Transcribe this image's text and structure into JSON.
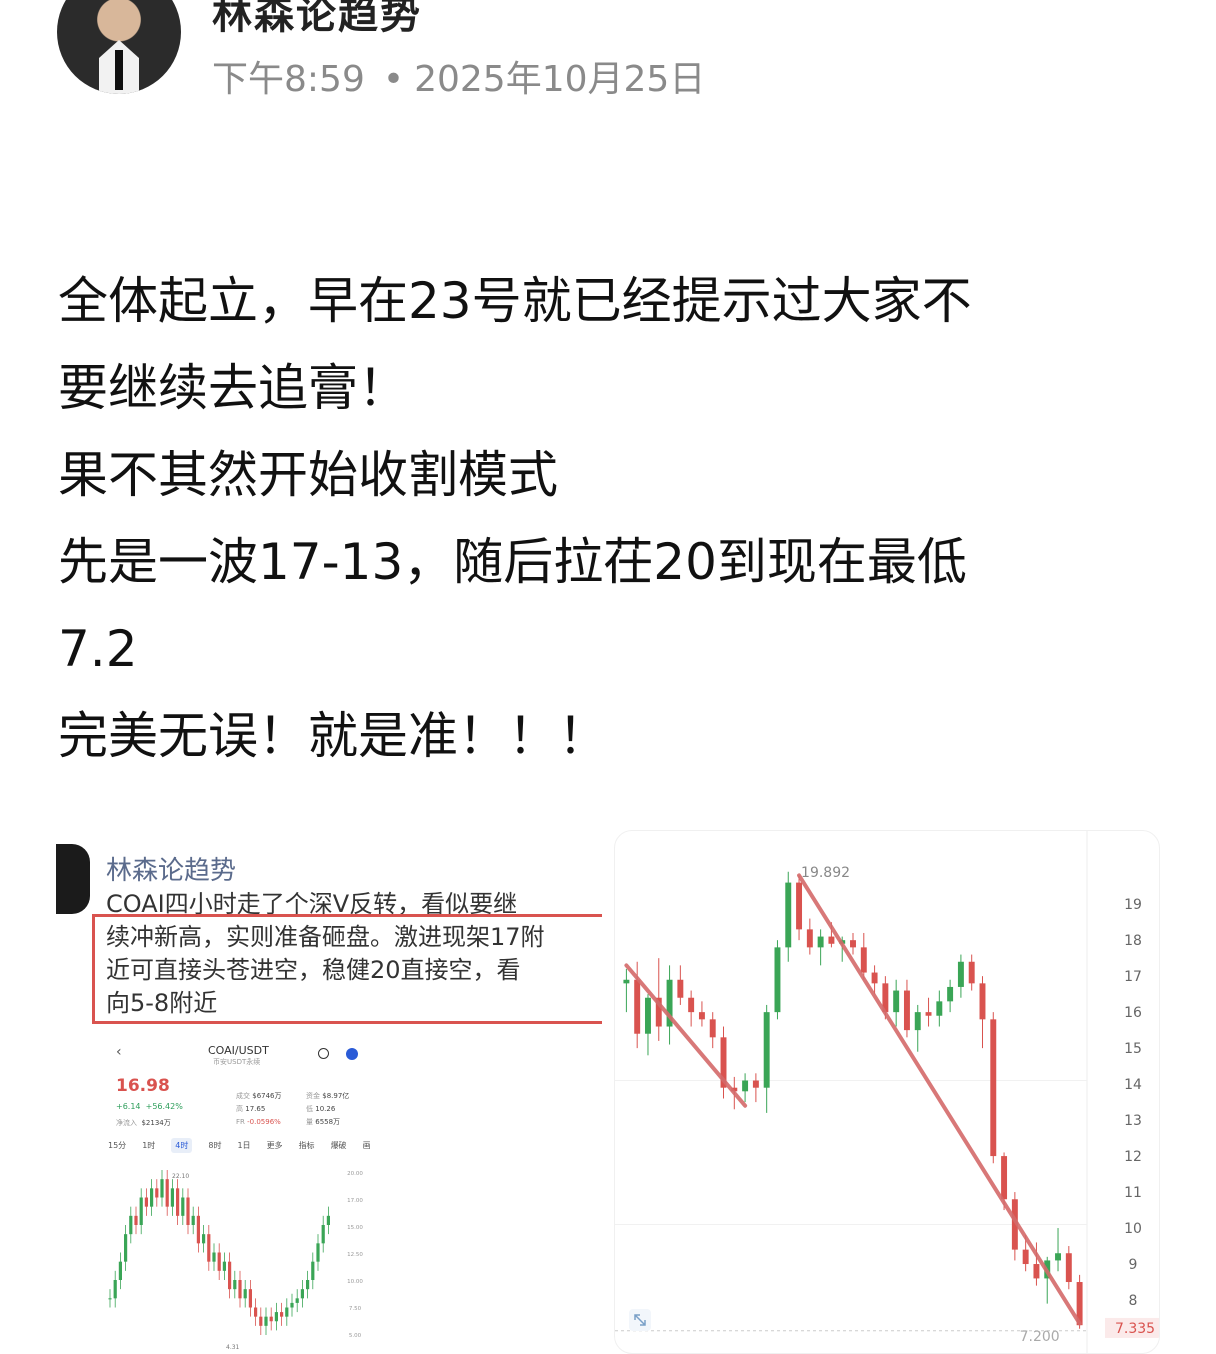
{
  "header": {
    "author": "林森论趋势",
    "time": "下午8:59",
    "date": "2025年10月25日"
  },
  "post": {
    "lines": [
      "全体起立，早在23号就已经提示过大家不",
      "要继续去追膏！",
      "果不其然开始收割模式",
      "先是一波17-13，随后拉�europe20到现在最低",
      "7.2",
      "完美无误！就是准！！！"
    ]
  },
  "left_image": {
    "author": "林森论趋势",
    "text_lines": [
      "COAI四小时走了个深V反转，看似要继",
      "续冲新高，实则准备砸盘。激进现架17附",
      "近可直接头苍进空，稳健20直接空，看",
      "向5-8附近"
    ],
    "pair": "COAI/USDT",
    "pair_sub": "币安USDT永续",
    "price": "16.98",
    "change": "+6.14",
    "change_pct": "+56.42%",
    "net_in": "净流入",
    "net_in_val": "$2134万",
    "stats": [
      {
        "label": "成交",
        "value": "$6746万"
      },
      {
        "label": "高",
        "value": "17.65"
      },
      {
        "label": "低",
        "value": "10.26"
      },
      {
        "label": "资金",
        "value": "$8.97亿"
      },
      {
        "label": "FR",
        "value": "-0.0596%"
      },
      {
        "label": "量",
        "value": "6558万"
      }
    ],
    "tabs": [
      "15分",
      "1时",
      "4时",
      "8时",
      "1日",
      "更多",
      "指标",
      "爆破",
      "画"
    ],
    "active_tab": "4时",
    "mini_chart": {
      "high_label": "22.10",
      "low_label": "4.31",
      "y_ticks": [
        "20.00",
        "17.00",
        "15.00",
        "12.50",
        "10.00",
        "7.50",
        "5.00"
      ]
    }
  },
  "chart_data": {
    "type": "candlestick",
    "title": "",
    "y_ticks": [
      19,
      18,
      17,
      16,
      15,
      14,
      13,
      12,
      11,
      10,
      9,
      8
    ],
    "ylim": [
      7,
      20.2
    ],
    "high_label": "19.892",
    "low_label": "7.200",
    "last_price_label": "7.335",
    "grid": true,
    "candles": [
      {
        "o": 16.8,
        "h": 17.2,
        "l": 16.0,
        "c": 16.9
      },
      {
        "o": 16.9,
        "h": 17.4,
        "l": 15.0,
        "c": 15.4
      },
      {
        "o": 15.4,
        "h": 16.5,
        "l": 14.8,
        "c": 16.4
      },
      {
        "o": 16.4,
        "h": 17.5,
        "l": 15.2,
        "c": 15.6
      },
      {
        "o": 15.6,
        "h": 17.3,
        "l": 15.1,
        "c": 16.9
      },
      {
        "o": 16.9,
        "h": 17.3,
        "l": 16.2,
        "c": 16.4
      },
      {
        "o": 16.4,
        "h": 16.6,
        "l": 15.6,
        "c": 16.0
      },
      {
        "o": 16.0,
        "h": 16.3,
        "l": 15.6,
        "c": 15.8
      },
      {
        "o": 15.8,
        "h": 16.0,
        "l": 15.0,
        "c": 15.3
      },
      {
        "o": 15.3,
        "h": 15.6,
        "l": 13.6,
        "c": 13.9
      },
      {
        "o": 13.9,
        "h": 14.2,
        "l": 13.3,
        "c": 13.8
      },
      {
        "o": 13.8,
        "h": 14.3,
        "l": 13.5,
        "c": 14.1
      },
      {
        "o": 14.1,
        "h": 14.3,
        "l": 13.5,
        "c": 13.9
      },
      {
        "o": 13.9,
        "h": 16.2,
        "l": 13.2,
        "c": 16.0
      },
      {
        "o": 16.0,
        "h": 18.0,
        "l": 15.8,
        "c": 17.8
      },
      {
        "o": 17.8,
        "h": 19.9,
        "l": 17.4,
        "c": 19.6
      },
      {
        "o": 19.6,
        "h": 19.8,
        "l": 18.0,
        "c": 18.3
      },
      {
        "o": 18.3,
        "h": 18.6,
        "l": 17.6,
        "c": 17.8
      },
      {
        "o": 17.8,
        "h": 18.3,
        "l": 17.3,
        "c": 18.1
      },
      {
        "o": 18.1,
        "h": 18.5,
        "l": 17.8,
        "c": 17.9
      },
      {
        "o": 17.9,
        "h": 18.1,
        "l": 17.4,
        "c": 18.0
      },
      {
        "o": 18.0,
        "h": 18.2,
        "l": 17.6,
        "c": 17.8
      },
      {
        "o": 17.8,
        "h": 18.2,
        "l": 16.9,
        "c": 17.1
      },
      {
        "o": 17.1,
        "h": 17.3,
        "l": 16.5,
        "c": 16.8
      },
      {
        "o": 16.8,
        "h": 17.0,
        "l": 15.8,
        "c": 16.0
      },
      {
        "o": 16.0,
        "h": 16.9,
        "l": 15.6,
        "c": 16.6
      },
      {
        "o": 16.6,
        "h": 16.9,
        "l": 15.3,
        "c": 15.5
      },
      {
        "o": 15.5,
        "h": 16.2,
        "l": 14.9,
        "c": 16.0
      },
      {
        "o": 16.0,
        "h": 16.4,
        "l": 15.6,
        "c": 15.9
      },
      {
        "o": 15.9,
        "h": 16.6,
        "l": 15.6,
        "c": 16.3
      },
      {
        "o": 16.3,
        "h": 16.9,
        "l": 16.0,
        "c": 16.7
      },
      {
        "o": 16.7,
        "h": 17.6,
        "l": 16.4,
        "c": 17.4
      },
      {
        "o": 17.4,
        "h": 17.6,
        "l": 16.6,
        "c": 16.8
      },
      {
        "o": 16.8,
        "h": 17.0,
        "l": 15.0,
        "c": 15.8
      },
      {
        "o": 15.8,
        "h": 16.0,
        "l": 11.8,
        "c": 12.0
      },
      {
        "o": 12.0,
        "h": 12.1,
        "l": 10.5,
        "c": 10.8
      },
      {
        "o": 10.8,
        "h": 11.0,
        "l": 9.1,
        "c": 9.4
      },
      {
        "o": 9.4,
        "h": 9.8,
        "l": 8.8,
        "c": 9.0
      },
      {
        "o": 9.0,
        "h": 9.6,
        "l": 8.4,
        "c": 8.6
      },
      {
        "o": 8.6,
        "h": 9.2,
        "l": 7.9,
        "c": 9.1
      },
      {
        "o": 9.1,
        "h": 10.0,
        "l": 8.8,
        "c": 9.3
      },
      {
        "o": 9.3,
        "h": 9.5,
        "l": 8.3,
        "c": 8.5
      },
      {
        "o": 8.5,
        "h": 8.7,
        "l": 7.2,
        "c": 7.3
      }
    ],
    "trendlines": [
      {
        "from": [
          0,
          17.3
        ],
        "to": [
          11,
          13.4
        ]
      },
      {
        "from": [
          16,
          19.8
        ],
        "to": [
          42,
          7.35
        ]
      }
    ],
    "colors": {
      "up": "#3aa556",
      "down": "#d9534f",
      "trend": "#d46a6a"
    }
  }
}
